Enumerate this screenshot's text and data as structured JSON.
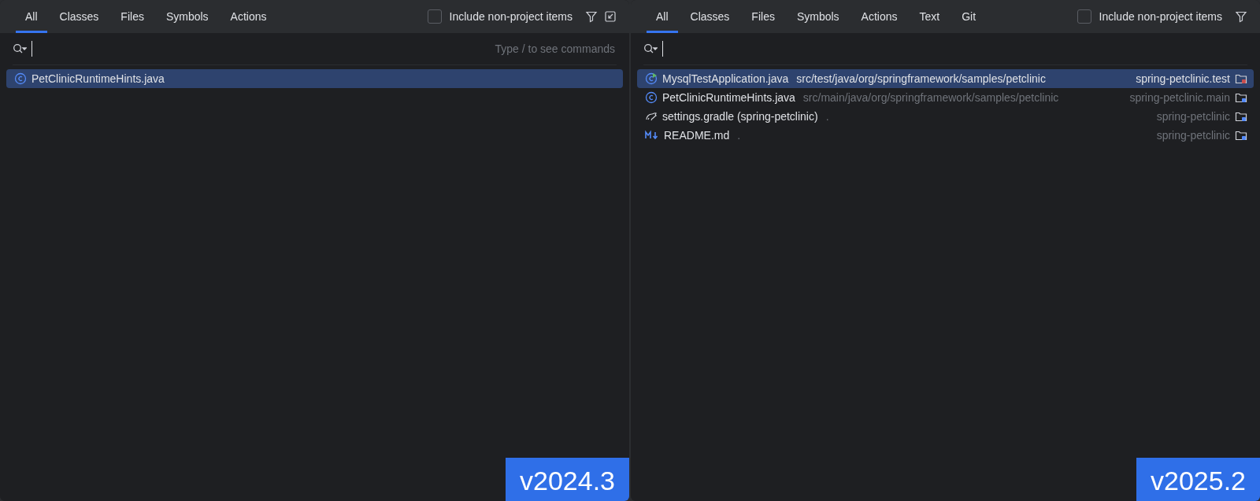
{
  "panels": [
    {
      "tabs": [
        {
          "label": "All",
          "selected": true
        },
        {
          "label": "Classes",
          "selected": false
        },
        {
          "label": "Files",
          "selected": false
        },
        {
          "label": "Symbols",
          "selected": false
        },
        {
          "label": "Actions",
          "selected": false
        }
      ],
      "include_non_project": {
        "label": "Include non-project items",
        "checked": false
      },
      "show_collapse": true,
      "search": {
        "placeholder": "Type / to see commands"
      },
      "results": [
        {
          "kind": "class",
          "name": "PetClinicRuntimeHints.java",
          "selected": true
        }
      ],
      "version_badge": "v2024.3"
    },
    {
      "tabs": [
        {
          "label": "All",
          "selected": true
        },
        {
          "label": "Classes",
          "selected": false
        },
        {
          "label": "Files",
          "selected": false
        },
        {
          "label": "Symbols",
          "selected": false
        },
        {
          "label": "Actions",
          "selected": false
        },
        {
          "label": "Text",
          "selected": false
        },
        {
          "label": "Git",
          "selected": false
        }
      ],
      "include_non_project": {
        "label": "Include non-project items",
        "checked": false
      },
      "show_collapse": false,
      "results": [
        {
          "kind": "run",
          "name": "MysqlTestApplication.java",
          "path": "src/test/java/org/springframework/samples/petclinic",
          "module": "spring-petclinic.test",
          "selected": true
        },
        {
          "kind": "class",
          "name": "PetClinicRuntimeHints.java",
          "path": "src/main/java/org/springframework/samples/petclinic",
          "module": "spring-petclinic.main",
          "selected": false
        },
        {
          "kind": "gradle",
          "name": "settings.gradle (spring-petclinic)",
          "path": ".",
          "module": "spring-petclinic",
          "selected": false
        },
        {
          "kind": "markdown",
          "name": "README.md",
          "path": ".",
          "module": "spring-petclinic",
          "selected": false
        }
      ],
      "version_badge": "v2025.2"
    }
  ]
}
